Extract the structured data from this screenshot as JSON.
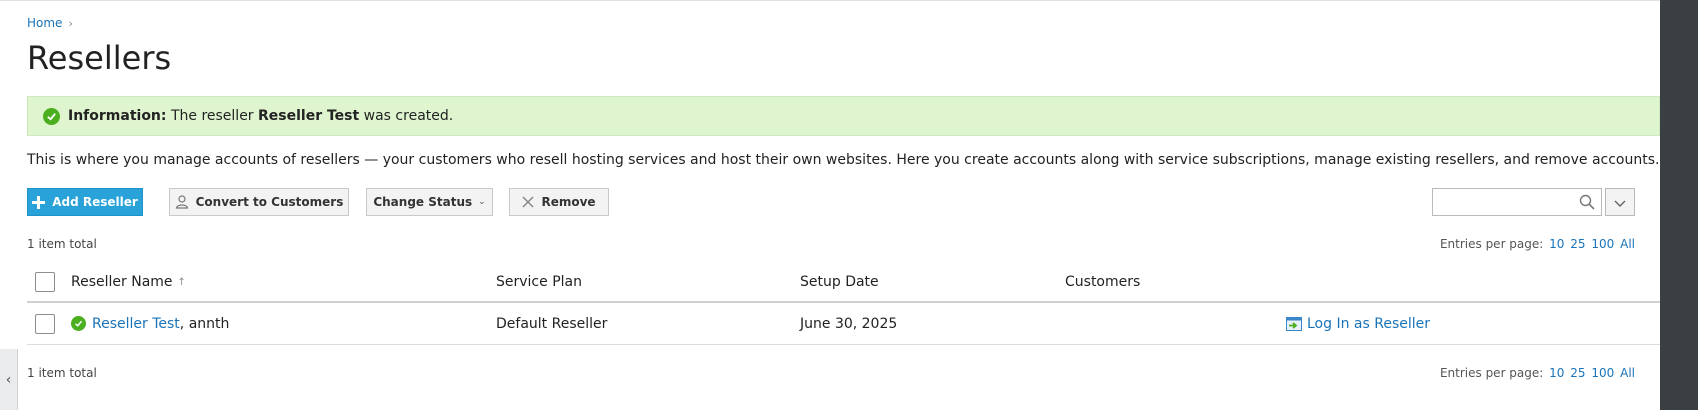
{
  "breadcrumb": {
    "home": "Home",
    "sep": "›"
  },
  "page_title": "Resellers",
  "message": {
    "label": "Information:",
    "text_before": "The reseller",
    "name": "Reseller Test",
    "text_after": "was created."
  },
  "description": "This is where you manage accounts of resellers — your customers who resell hosting services and host their own websites. Here you create accounts along with service subscriptions, manage existing resellers, and remove accounts.",
  "toolbar": {
    "add": "Add Reseller",
    "convert": "Convert to Customers",
    "change_status": "Change Status",
    "remove": "Remove",
    "search_placeholder": ""
  },
  "totals": {
    "top": "1 item total",
    "bottom": "1 item total"
  },
  "paging": {
    "label": "Entries per page:",
    "options": [
      "10",
      "25",
      "100",
      "All"
    ]
  },
  "table": {
    "columns": [
      "Reseller Name",
      "Service Plan",
      "Setup Date",
      "Customers"
    ],
    "sort_indicator": "↑",
    "rows": [
      {
        "name": "Reseller Test",
        "login": ", annth",
        "plan": "Default Reseller",
        "date": "June 30, 2025",
        "customers": "",
        "action": "Log In as Reseller",
        "status": "active"
      }
    ]
  },
  "colors": {
    "accent": "#28a2d8",
    "link": "#1a73b8",
    "success_bg": "#dff5d0",
    "success_icon": "#4caf1f"
  },
  "icons": {
    "add": "plus-icon",
    "convert": "user-icon",
    "remove": "x-icon",
    "search": "magnifier-icon",
    "login": "login-as-icon",
    "status": "check-circle-icon"
  }
}
